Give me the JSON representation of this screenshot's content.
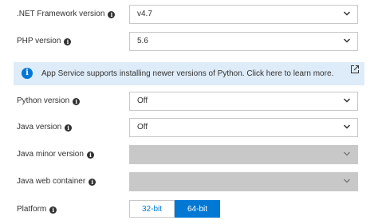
{
  "fields": [
    {
      "label": ".NET Framework version",
      "value": "v4.7",
      "disabled": false
    },
    {
      "label": "PHP version",
      "value": "5.6",
      "disabled": false
    },
    {
      "label": "Python version",
      "value": "Off",
      "disabled": false
    },
    {
      "label": "Java version",
      "value": "Off",
      "disabled": false
    },
    {
      "label": "Java minor version",
      "value": "",
      "disabled": true
    },
    {
      "label": "Java web container",
      "value": "",
      "disabled": true
    }
  ],
  "banner": {
    "text": "App Service supports installing newer versions of Python. Click here to learn more."
  },
  "platform": {
    "label": "Platform",
    "options": [
      "32-bit",
      "64-bit"
    ],
    "selected": "64-bit"
  },
  "colors": {
    "accent": "#0078d4",
    "banner_bg": "#deecf9",
    "disabled_bg": "#c8c8c8"
  },
  "icons": {
    "info": "info-icon",
    "chevron": "chevron-down-icon",
    "external": "external-link-icon"
  }
}
